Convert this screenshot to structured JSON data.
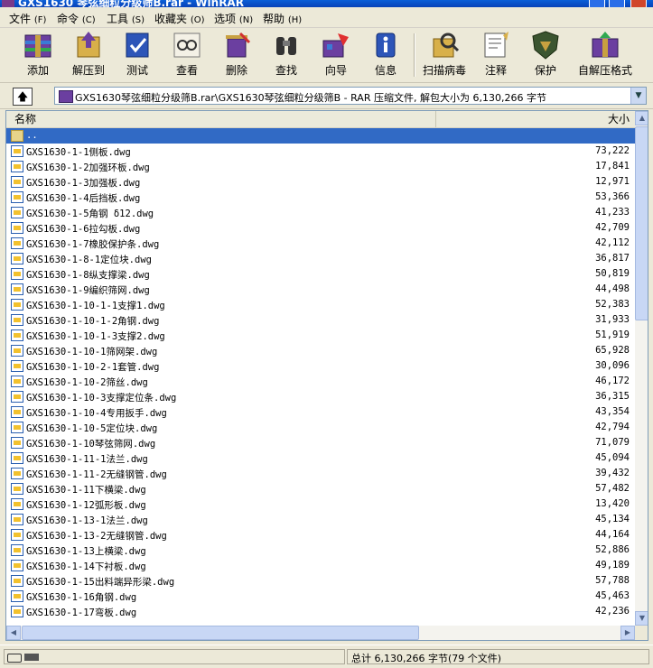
{
  "window": {
    "title": "GXS1630 琴弦细粒分级筛B.rar - WinRAR"
  },
  "menu": [
    {
      "label": "文件",
      "accel": "(F)"
    },
    {
      "label": "命令",
      "accel": "(C)"
    },
    {
      "label": "工具",
      "accel": "(S)"
    },
    {
      "label": "收藏夹",
      "accel": "(O)"
    },
    {
      "label": "选项",
      "accel": "(N)"
    },
    {
      "label": "帮助",
      "accel": "(H)"
    }
  ],
  "toolbar": [
    {
      "label": "添加",
      "icon": "add-archive-icon"
    },
    {
      "label": "解压到",
      "icon": "extract-to-icon"
    },
    {
      "label": "测试",
      "icon": "test-icon"
    },
    {
      "label": "查看",
      "icon": "view-icon"
    },
    {
      "label": "删除",
      "icon": "delete-icon"
    },
    {
      "label": "查找",
      "icon": "find-icon"
    },
    {
      "label": "向导",
      "icon": "wizard-icon"
    },
    {
      "label": "信息",
      "icon": "info-icon"
    },
    {
      "label": "扫描病毒",
      "icon": "virus-scan-icon"
    },
    {
      "label": "注释",
      "icon": "comment-icon"
    },
    {
      "label": "保护",
      "icon": "protect-icon"
    },
    {
      "label": "自解压格式",
      "icon": "sfx-icon"
    }
  ],
  "address": {
    "path": "GXS1630琴弦细粒分级筛B.rar\\GXS1630琴弦细粒分级筛B - RAR 压缩文件, 解包大小为 6,130,266 字节"
  },
  "list": {
    "col_name": "名称",
    "col_size": "大小",
    "parent_label": "..",
    "files": [
      {
        "name": "GXS1630-1-1侧板.dwg",
        "size": "73,222"
      },
      {
        "name": "GXS1630-1-2加强环板.dwg",
        "size": "17,841"
      },
      {
        "name": "GXS1630-1-3加强板.dwg",
        "size": "12,971"
      },
      {
        "name": "GXS1630-1-4后挡板.dwg",
        "size": "53,366"
      },
      {
        "name": "GXS1630-1-5角钢 δ12.dwg",
        "size": "41,233"
      },
      {
        "name": "GXS1630-1-6拉勾板.dwg",
        "size": "42,709"
      },
      {
        "name": "GXS1630-1-7橡胶保护条.dwg",
        "size": "42,112"
      },
      {
        "name": "GXS1630-1-8-1定位块.dwg",
        "size": "36,817"
      },
      {
        "name": "GXS1630-1-8纵支撑梁.dwg",
        "size": "50,819"
      },
      {
        "name": "GXS1630-1-9编织筛网.dwg",
        "size": "44,498"
      },
      {
        "name": "GXS1630-1-10-1-1支撑1.dwg",
        "size": "52,383"
      },
      {
        "name": "GXS1630-1-10-1-2角钢.dwg",
        "size": "31,933"
      },
      {
        "name": "GXS1630-1-10-1-3支撑2.dwg",
        "size": "51,919"
      },
      {
        "name": "GXS1630-1-10-1筛网架.dwg",
        "size": "65,928"
      },
      {
        "name": "GXS1630-1-10-2-1套管.dwg",
        "size": "30,096"
      },
      {
        "name": "GXS1630-1-10-2筛丝.dwg",
        "size": "46,172"
      },
      {
        "name": "GXS1630-1-10-3支撑定位条.dwg",
        "size": "36,315"
      },
      {
        "name": "GXS1630-1-10-4专用扳手.dwg",
        "size": "43,354"
      },
      {
        "name": "GXS1630-1-10-5定位块.dwg",
        "size": "42,794"
      },
      {
        "name": "GXS1630-1-10琴弦筛网.dwg",
        "size": "71,079"
      },
      {
        "name": "GXS1630-1-11-1法兰.dwg",
        "size": "45,094"
      },
      {
        "name": "GXS1630-1-11-2无缝钢管.dwg",
        "size": "39,432"
      },
      {
        "name": "GXS1630-1-11下横梁.dwg",
        "size": "57,482"
      },
      {
        "name": "GXS1630-1-12弧形板.dwg",
        "size": "13,420"
      },
      {
        "name": "GXS1630-1-13-1法兰.dwg",
        "size": "45,134"
      },
      {
        "name": "GXS1630-1-13-2无缝钢管.dwg",
        "size": "44,164"
      },
      {
        "name": "GXS1630-1-13上横梁.dwg",
        "size": "52,886"
      },
      {
        "name": "GXS1630-1-14下衬板.dwg",
        "size": "49,189"
      },
      {
        "name": "GXS1630-1-15出料端异形梁.dwg",
        "size": "57,788"
      },
      {
        "name": "GXS1630-1-16角钢.dwg",
        "size": "45,463"
      },
      {
        "name": "GXS1630-1-17弯板.dwg",
        "size": "42,236"
      }
    ]
  },
  "status": {
    "summary": "总计 6,130,266 字节(79 个文件)"
  },
  "colors": {
    "selection": "#316ac5",
    "titlebar": "#0a5fd8"
  }
}
